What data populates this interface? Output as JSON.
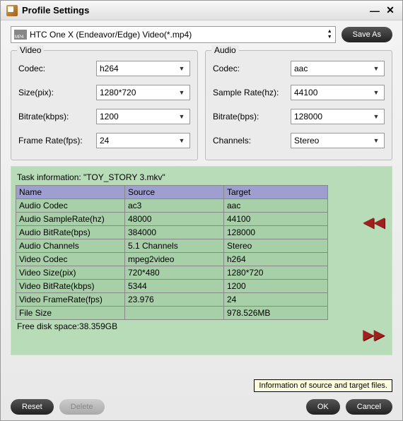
{
  "window": {
    "title": "Profile Settings"
  },
  "profile": {
    "selected": "HTC One X (Endeavor/Edge) Video(*.mp4)",
    "save_as": "Save As"
  },
  "video": {
    "title": "Video",
    "codec_label": "Codec:",
    "codec": "h264",
    "size_label": "Size(pix):",
    "size": "1280*720",
    "bitrate_label": "Bitrate(kbps):",
    "bitrate": "1200",
    "framerate_label": "Frame Rate(fps):",
    "framerate": "24"
  },
  "audio": {
    "title": "Audio",
    "codec_label": "Codec:",
    "codec": "aac",
    "samplerate_label": "Sample Rate(hz):",
    "samplerate": "44100",
    "bitrate_label": "Bitrate(bps):",
    "bitrate": "128000",
    "channels_label": "Channels:",
    "channels": "Stereo"
  },
  "task": {
    "title": "Task information: \"TOY_STORY 3.mkv\"",
    "headers": {
      "name": "Name",
      "source": "Source",
      "target": "Target"
    },
    "rows": [
      {
        "name": "Audio Codec",
        "source": "ac3",
        "target": "aac"
      },
      {
        "name": "Audio SampleRate(hz)",
        "source": "48000",
        "target": "44100"
      },
      {
        "name": "Audio BitRate(bps)",
        "source": "384000",
        "target": "128000"
      },
      {
        "name": "Audio Channels",
        "source": "5.1 Channels",
        "target": "Stereo"
      },
      {
        "name": "Video Codec",
        "source": "mpeg2video",
        "target": "h264"
      },
      {
        "name": "Video Size(pix)",
        "source": "720*480",
        "target": "1280*720"
      },
      {
        "name": "Video BitRate(kbps)",
        "source": "5344",
        "target": "1200"
      },
      {
        "name": "Video FrameRate(fps)",
        "source": "23.976",
        "target": "24"
      },
      {
        "name": "File Size",
        "source": "",
        "target": "978.526MB"
      }
    ],
    "free_space": "Free disk space:38.359GB"
  },
  "tooltip": "Information of source and target files.",
  "footer": {
    "reset": "Reset",
    "delete": "Delete",
    "ok": "OK",
    "cancel": "Cancel"
  }
}
